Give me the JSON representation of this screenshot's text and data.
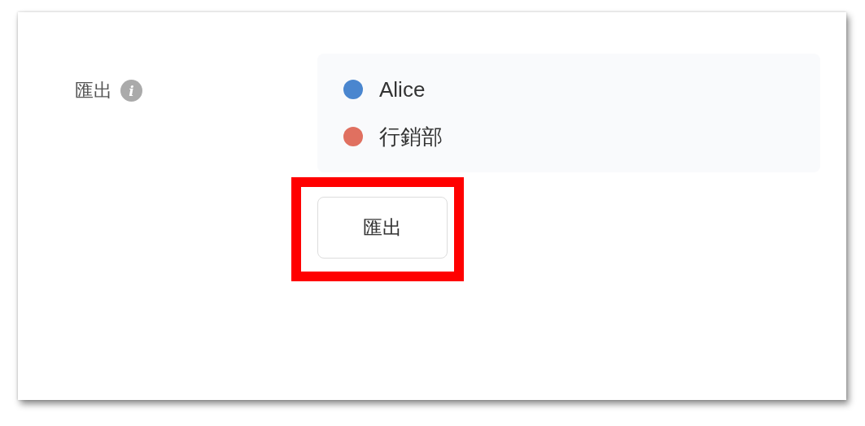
{
  "field": {
    "label": "匯出",
    "info_icon": "i"
  },
  "recipients": [
    {
      "name": "Alice",
      "color": "#4a86cf"
    },
    {
      "name": "行銷部",
      "color": "#e07060"
    }
  ],
  "export_button": {
    "label": "匯出",
    "highlighted": true
  }
}
